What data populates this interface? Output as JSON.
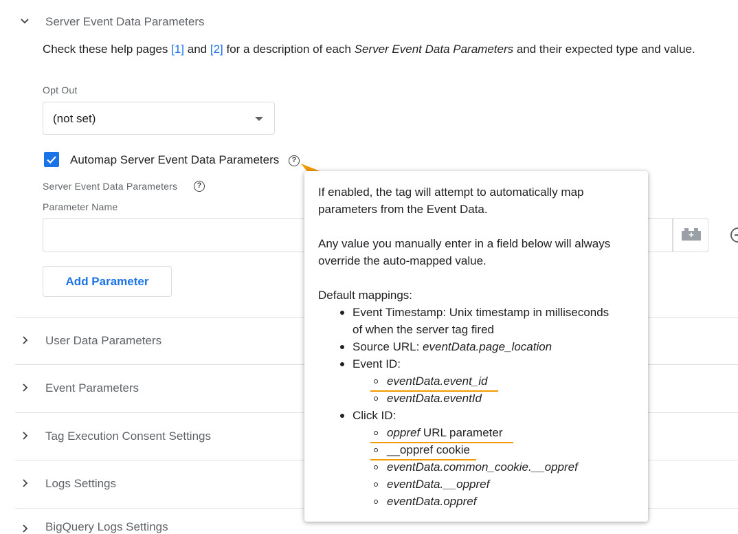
{
  "server_event_section": {
    "title": "Server Event Data Parameters",
    "help_prefix": "Check these help pages ",
    "link1": "[1]",
    "help_and": " and ",
    "link2": "[2]",
    "help_mid": " for a description of each ",
    "help_em": "Server Event Data Parameters",
    "help_suffix": " and their expected type and value."
  },
  "opt_out": {
    "label": "Opt Out",
    "value": "(not set)"
  },
  "automap": {
    "checked": true,
    "label": "Automap Server Event Data Parameters",
    "help_icon": "help-circle-icon"
  },
  "params": {
    "label": "Server Event Data Parameters",
    "column_label": "Parameter Name",
    "name_value": "",
    "add_button": "Add Parameter"
  },
  "tooltip": {
    "line1": "If enabled, the tag will attempt to automatically map",
    "line2": "parameters from the Event Data.",
    "line3": "Any value you manually enter in a field below will always",
    "line4": "override the auto-mapped value.",
    "default_heading": "Default mappings:",
    "timestamp_a": "Event Timestamp: Unix timestamp in milliseconds",
    "timestamp_b": "of when the server tag fired",
    "source_prefix": "Source URL: ",
    "source_em": "eventData.page_location",
    "event_id": "Event ID:",
    "event_id_1": "eventData.event_id",
    "event_id_2": "eventData.eventId",
    "click_id": "Click ID:",
    "click_1_em": "oppref",
    "click_1_rest": " URL parameter",
    "click_2": "__oppref cookie",
    "click_3": "eventData.common_cookie.__oppref",
    "click_4": "eventData.__oppref",
    "click_5": "eventData.oppref"
  },
  "sections": [
    {
      "title": "User Data Parameters"
    },
    {
      "title": "Event Parameters"
    },
    {
      "title": "Tag Execution Consent Settings"
    },
    {
      "title": "Logs Settings"
    },
    {
      "title": "BigQuery Logs Settings"
    }
  ],
  "colors": {
    "accent": "#1a73e8",
    "highlight": "#f29900"
  }
}
